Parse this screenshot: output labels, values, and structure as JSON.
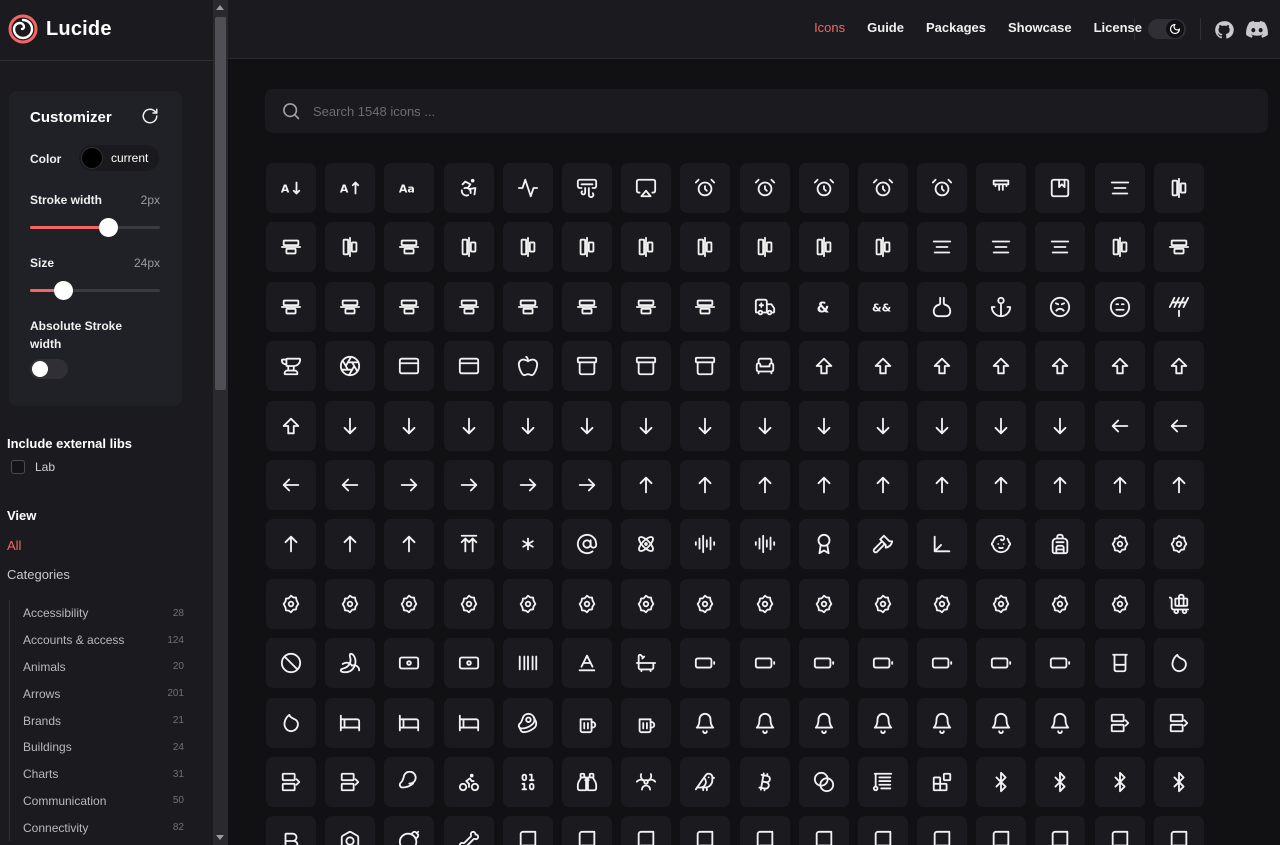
{
  "app": {
    "name": "Lucide",
    "brand_color": "#f56565"
  },
  "nav": {
    "links": [
      {
        "label": "Icons",
        "active": true
      },
      {
        "label": "Guide",
        "active": false
      },
      {
        "label": "Packages",
        "active": false
      },
      {
        "label": "Showcase",
        "active": false
      },
      {
        "label": "License",
        "active": false
      }
    ],
    "theme_icon": "moon-icon",
    "github_icon": "github-icon",
    "discord_icon": "discord-icon"
  },
  "customizer": {
    "title": "Customizer",
    "reset_icon": "rotate-cw-icon",
    "color_label": "Color",
    "color_value": "current",
    "stroke_label": "Stroke width",
    "stroke_value": "2px",
    "stroke_fraction": 0.6,
    "size_label": "Size",
    "size_value": "24px",
    "size_fraction": 0.25,
    "absolute_label": "Absolute Stroke width",
    "absolute_enabled": false
  },
  "external": {
    "title": "Include external libs",
    "lab_label": "Lab",
    "lab_checked": false
  },
  "view": {
    "title": "View",
    "all_label": "All",
    "categories_label": "Categories",
    "categories": [
      {
        "label": "Accessibility",
        "count": "28"
      },
      {
        "label": "Accounts & access",
        "count": "124"
      },
      {
        "label": "Animals",
        "count": "20"
      },
      {
        "label": "Arrows",
        "count": "201"
      },
      {
        "label": "Brands",
        "count": "21"
      },
      {
        "label": "Buildings",
        "count": "24"
      },
      {
        "label": "Charts",
        "count": "31"
      },
      {
        "label": "Communication",
        "count": "50"
      },
      {
        "label": "Connectivity",
        "count": "82"
      }
    ]
  },
  "search": {
    "placeholder": "Search 1548 icons ..."
  },
  "icons": [
    "a-arrow-down",
    "a-arrow-up",
    "a-large-small",
    "accessibility",
    "activity",
    "air-vent",
    "airplay",
    "alarm-clock",
    "alarm-clock-check",
    "alarm-clock-minus",
    "alarm-clock-off",
    "alarm-clock-plus",
    "alarm-smoke",
    "album",
    "align-center",
    "align-center-horizontal",
    "align-center-vertical",
    "align-end-horizontal",
    "align-end-vertical",
    "align-horizontal-distribute-center",
    "align-horizontal-distribute-end",
    "align-horizontal-distribute-start",
    "align-horizontal-justify-center",
    "align-horizontal-justify-end",
    "align-horizontal-justify-start",
    "align-horizontal-space-around",
    "align-horizontal-space-between",
    "align-justify",
    "align-left",
    "align-right",
    "align-start-horizontal",
    "align-start-vertical",
    "align-vertical-distribute-center",
    "align-vertical-distribute-end",
    "align-vertical-distribute-start",
    "align-vertical-justify-center",
    "align-vertical-justify-end",
    "align-vertical-justify-start",
    "align-vertical-space-around",
    "align-vertical-space-between",
    "ambulance",
    "ampersand",
    "ampersands",
    "amphora",
    "anchor",
    "angry",
    "annoyed",
    "antenna",
    "anvil",
    "aperture",
    "app-window",
    "app-window-mac",
    "apple",
    "archive",
    "archive-restore",
    "archive-x",
    "armchair",
    "arrow-big-down",
    "arrow-big-down-dash",
    "arrow-big-left",
    "arrow-big-left-dash",
    "arrow-big-right",
    "arrow-big-right-dash",
    "arrow-big-up",
    "arrow-big-up-dash",
    "arrow-down",
    "arrow-down-0-1",
    "arrow-down-1-0",
    "arrow-down-a-z",
    "arrow-down-from-line",
    "arrow-down-left",
    "arrow-down-narrow-wide",
    "arrow-down-right",
    "arrow-down-to-dot",
    "arrow-down-to-line",
    "arrow-down-up",
    "arrow-down-wide-narrow",
    "arrow-down-z-a",
    "arrow-left",
    "arrow-left-from-line",
    "arrow-left-right",
    "arrow-left-to-line",
    "arrow-right",
    "arrow-right-from-line",
    "arrow-right-left",
    "arrow-right-to-line",
    "arrow-up",
    "arrow-up-0-1",
    "arrow-up-1-0",
    "arrow-up-a-z",
    "arrow-up-down",
    "arrow-up-from-dot",
    "arrow-up-from-line",
    "arrow-up-left",
    "arrow-up-narrow-wide",
    "arrow-up-right",
    "arrow-up-to-line",
    "arrow-up-wide-narrow",
    "arrow-up-z-a",
    "arrows-up-from-line",
    "asterisk",
    "at-sign",
    "atom",
    "audio-lines",
    "audio-waveform",
    "award",
    "axe",
    "axis-3d",
    "baby",
    "backpack",
    "badge",
    "badge-alert",
    "badge-cent",
    "badge-check",
    "badge-dollar-sign",
    "badge-euro",
    "badge-help",
    "badge-indian-rupee",
    "badge-info",
    "badge-japanese-yen",
    "badge-minus",
    "badge-percent",
    "badge-plus",
    "badge-pound-sterling",
    "badge-russian-ruble",
    "badge-swiss-franc",
    "badge-x",
    "baggage-claim",
    "ban",
    "banana",
    "banknote",
    "banknote-arrow",
    "barcode",
    "baseline",
    "bath",
    "battery",
    "battery-charging",
    "battery-full",
    "battery-low",
    "battery-medium",
    "battery-plus",
    "battery-warning",
    "beaker",
    "bean",
    "bean-off",
    "bed",
    "bed-double",
    "bed-single",
    "beef",
    "beer",
    "beer-off",
    "bell",
    "bell-dot",
    "bell-electric",
    "bell-minus",
    "bell-off",
    "bell-plus",
    "bell-ring",
    "between-horizontal-end",
    "between-horizontal-start",
    "between-vertical-end",
    "between-vertical-start",
    "biceps-flexed",
    "bike",
    "binary",
    "binoculars",
    "biohazard",
    "bird",
    "bitcoin",
    "blend",
    "blinds",
    "blocks",
    "bluetooth",
    "bluetooth-connected",
    "bluetooth-off",
    "bluetooth-searching",
    "bold",
    "bolt",
    "bomb",
    "bone",
    "book",
    "book-a",
    "book-audio",
    "book-check",
    "book-copy",
    "book-dashed",
    "book-down",
    "book-headphones",
    "book-heart",
    "book-image",
    "book-key",
    "book-lock"
  ]
}
